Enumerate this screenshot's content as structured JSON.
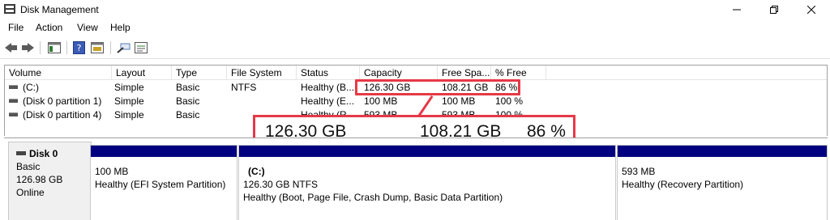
{
  "window": {
    "title": "Disk Management"
  },
  "menu": [
    "File",
    "Action",
    "View",
    "Help"
  ],
  "toolbar": {
    "icons": [
      "back-arrow-icon",
      "forward-arrow-icon",
      "console-tree-icon",
      "help-icon",
      "properties-icon",
      "connect-icon",
      "settings-list-icon"
    ]
  },
  "volume_list": {
    "columns": [
      "Volume",
      "Layout",
      "Type",
      "File System",
      "Status",
      "Capacity",
      "Free Spa...",
      "% Free"
    ],
    "rows": [
      {
        "volume": "(C:)",
        "layout": "Simple",
        "type": "Basic",
        "fs": "NTFS",
        "status": "Healthy (B...",
        "capacity": "126.30 GB",
        "free": "108.21 GB",
        "pct": "86 %"
      },
      {
        "volume": "(Disk 0 partition 1)",
        "layout": "Simple",
        "type": "Basic",
        "fs": "",
        "status": "Healthy (E...",
        "capacity": "100 MB",
        "free": "100 MB",
        "pct": "100 %"
      },
      {
        "volume": "(Disk 0 partition 4)",
        "layout": "Simple",
        "type": "Basic",
        "fs": "",
        "status": "Healthy (R...",
        "capacity": "593 MB",
        "free": "593 MB",
        "pct": "100 %"
      }
    ]
  },
  "highlight": {
    "capacity": "126.30 GB",
    "free": "108.21 GB",
    "pct": "86 %",
    "color": "#e63946"
  },
  "disk": {
    "name": "Disk 0",
    "type": "Basic",
    "size": "126.98 GB",
    "state": "Online",
    "partitions": [
      {
        "title": "",
        "size": "100 MB",
        "status": "Healthy (EFI System Partition)"
      },
      {
        "title": "(C:)",
        "size": "126.30 GB NTFS",
        "status": "Healthy (Boot, Page File, Crash Dump, Basic Data Partition)"
      },
      {
        "title": "",
        "size": "593 MB",
        "status": "Healthy (Recovery Partition)"
      }
    ],
    "bar_color": "#000080"
  }
}
